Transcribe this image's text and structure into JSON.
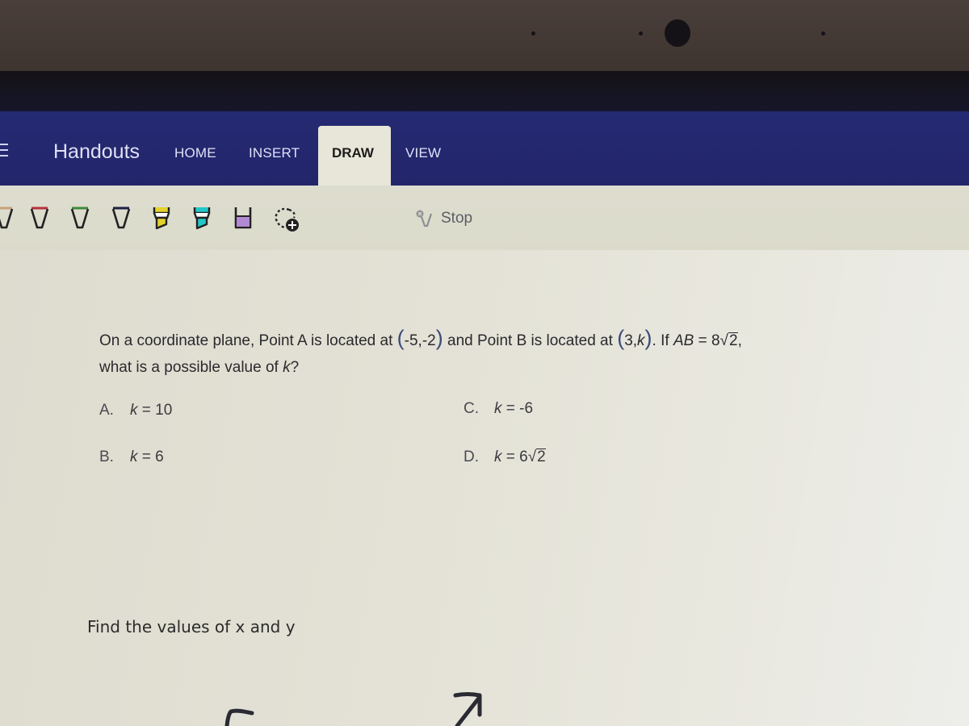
{
  "app": {
    "title": "Handouts",
    "menu_icon": "hamburger-menu-icon"
  },
  "tabs": [
    {
      "label": "HOME",
      "active": false
    },
    {
      "label": "INSERT",
      "active": false
    },
    {
      "label": "DRAW",
      "active": true
    },
    {
      "label": "VIEW",
      "active": false
    }
  ],
  "colors": {
    "ribbon": "#23266e",
    "active_tab": "#e7e6d8",
    "page": "#e4e2d6"
  },
  "draw_tools": [
    {
      "icon": "pen-icon",
      "color": "#c8a07a"
    },
    {
      "icon": "pen-icon",
      "color": "#b5323c"
    },
    {
      "icon": "pen-icon",
      "color": "#3f8a3a"
    },
    {
      "icon": "pen-icon",
      "color": "#1c1f45"
    },
    {
      "icon": "highlighter-icon",
      "color": "#e6d22c"
    },
    {
      "icon": "highlighter-icon",
      "color": "#22c8c8"
    },
    {
      "icon": "highlighter-icon",
      "color": "#b28ad4"
    },
    {
      "icon": "lasso-select-icon",
      "color": "#1a1a1a"
    }
  ],
  "stop_button": {
    "icon": "stop-ink-icon",
    "label": "Stop"
  },
  "question": {
    "line1_prefix": "On a coordinate plane, Point A is located at ",
    "point_a": "-5,-2",
    "line1_middle": " and Point B is located at ",
    "point_b_x": "3,",
    "point_b_k": "k",
    "line1_if": ". If ",
    "ab_label": "AB",
    "ab_equals": " = 8",
    "ab_radicand": "2",
    "line1_end": ",",
    "line2": "what is a possible value of ",
    "line2_var": "k",
    "line2_end": "?"
  },
  "choices": [
    {
      "letter": "A.",
      "var": "k",
      "rel": " = ",
      "value": "10",
      "radicand": ""
    },
    {
      "letter": "B.",
      "var": "k",
      "rel": " = ",
      "value": "6",
      "radicand": ""
    },
    {
      "letter": "C.",
      "var": "k",
      "rel": " = ",
      "value": "-6",
      "radicand": ""
    },
    {
      "letter": "D.",
      "var": "k",
      "rel": " = ",
      "value": "6",
      "radicand": "2"
    }
  ],
  "second_prompt": "Find the values of x and y"
}
